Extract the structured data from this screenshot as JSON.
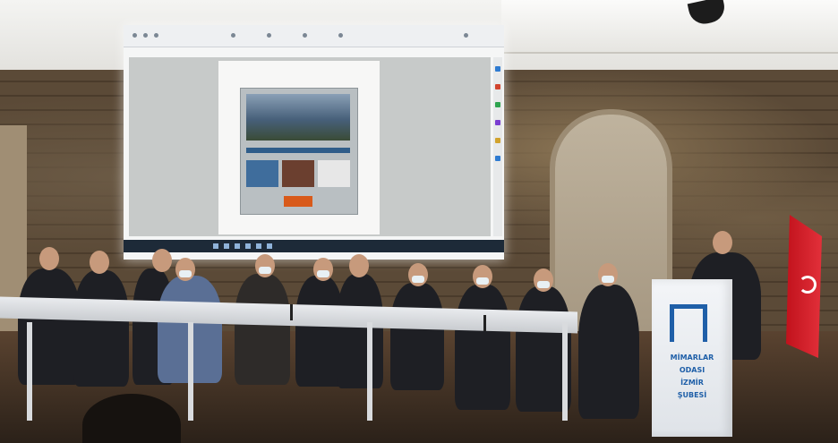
{
  "scene": {
    "description_hidden": "",
    "podium": {
      "line1": "MİMARLAR",
      "line2": "ODASI",
      "line3": "İZMİR",
      "line4": "ŞUBESİ"
    }
  },
  "colors": {
    "podium_brand": "#1f5fa8",
    "flag_red": "#e2303a",
    "cover_accent": "#d85a1a"
  },
  "icons": [
    "camera-icon",
    "flag-crescent-icon",
    "podium-logo-icon"
  ]
}
